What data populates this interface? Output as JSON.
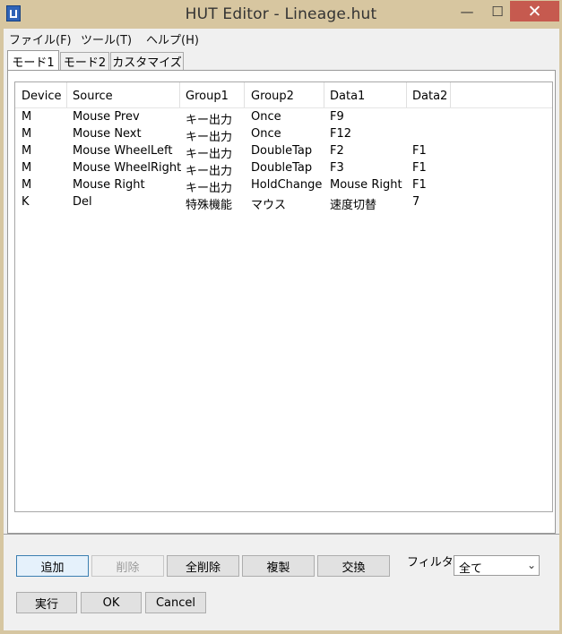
{
  "window": {
    "title": "HUT Editor - Lineage.hut"
  },
  "menu": [
    "ファイル(F)",
    "ツール(T)",
    "ヘルプ(H)"
  ],
  "tabs": [
    "モード1",
    "モード2",
    "カスタマイズ"
  ],
  "table": {
    "headers": [
      "Device",
      "Source",
      "Group1",
      "Group2",
      "Data1",
      "Data2"
    ],
    "rows": [
      [
        "M",
        "Mouse Prev",
        "キー出力",
        "Once",
        "F9",
        ""
      ],
      [
        "M",
        "Mouse Next",
        "キー出力",
        "Once",
        "F12",
        ""
      ],
      [
        "M",
        "Mouse WheelLeft",
        "キー出力",
        "DoubleTap",
        "F2",
        "F1"
      ],
      [
        "M",
        "Mouse WheelRight",
        "キー出力",
        "DoubleTap",
        "F3",
        "F1"
      ],
      [
        "M",
        "Mouse Right",
        "キー出力",
        "HoldChange",
        "Mouse Right",
        "F1"
      ],
      [
        "K",
        "Del",
        "特殊機能",
        "マウス",
        "速度切替",
        "7"
      ]
    ]
  },
  "buttons": {
    "add": "追加",
    "delete": "削除",
    "delete_all": "全削除",
    "duplicate": "複製",
    "swap": "交換",
    "run": "実行",
    "ok": "OK",
    "cancel": "Cancel"
  },
  "filter": {
    "label": "フィルタ",
    "selected": "全て"
  }
}
